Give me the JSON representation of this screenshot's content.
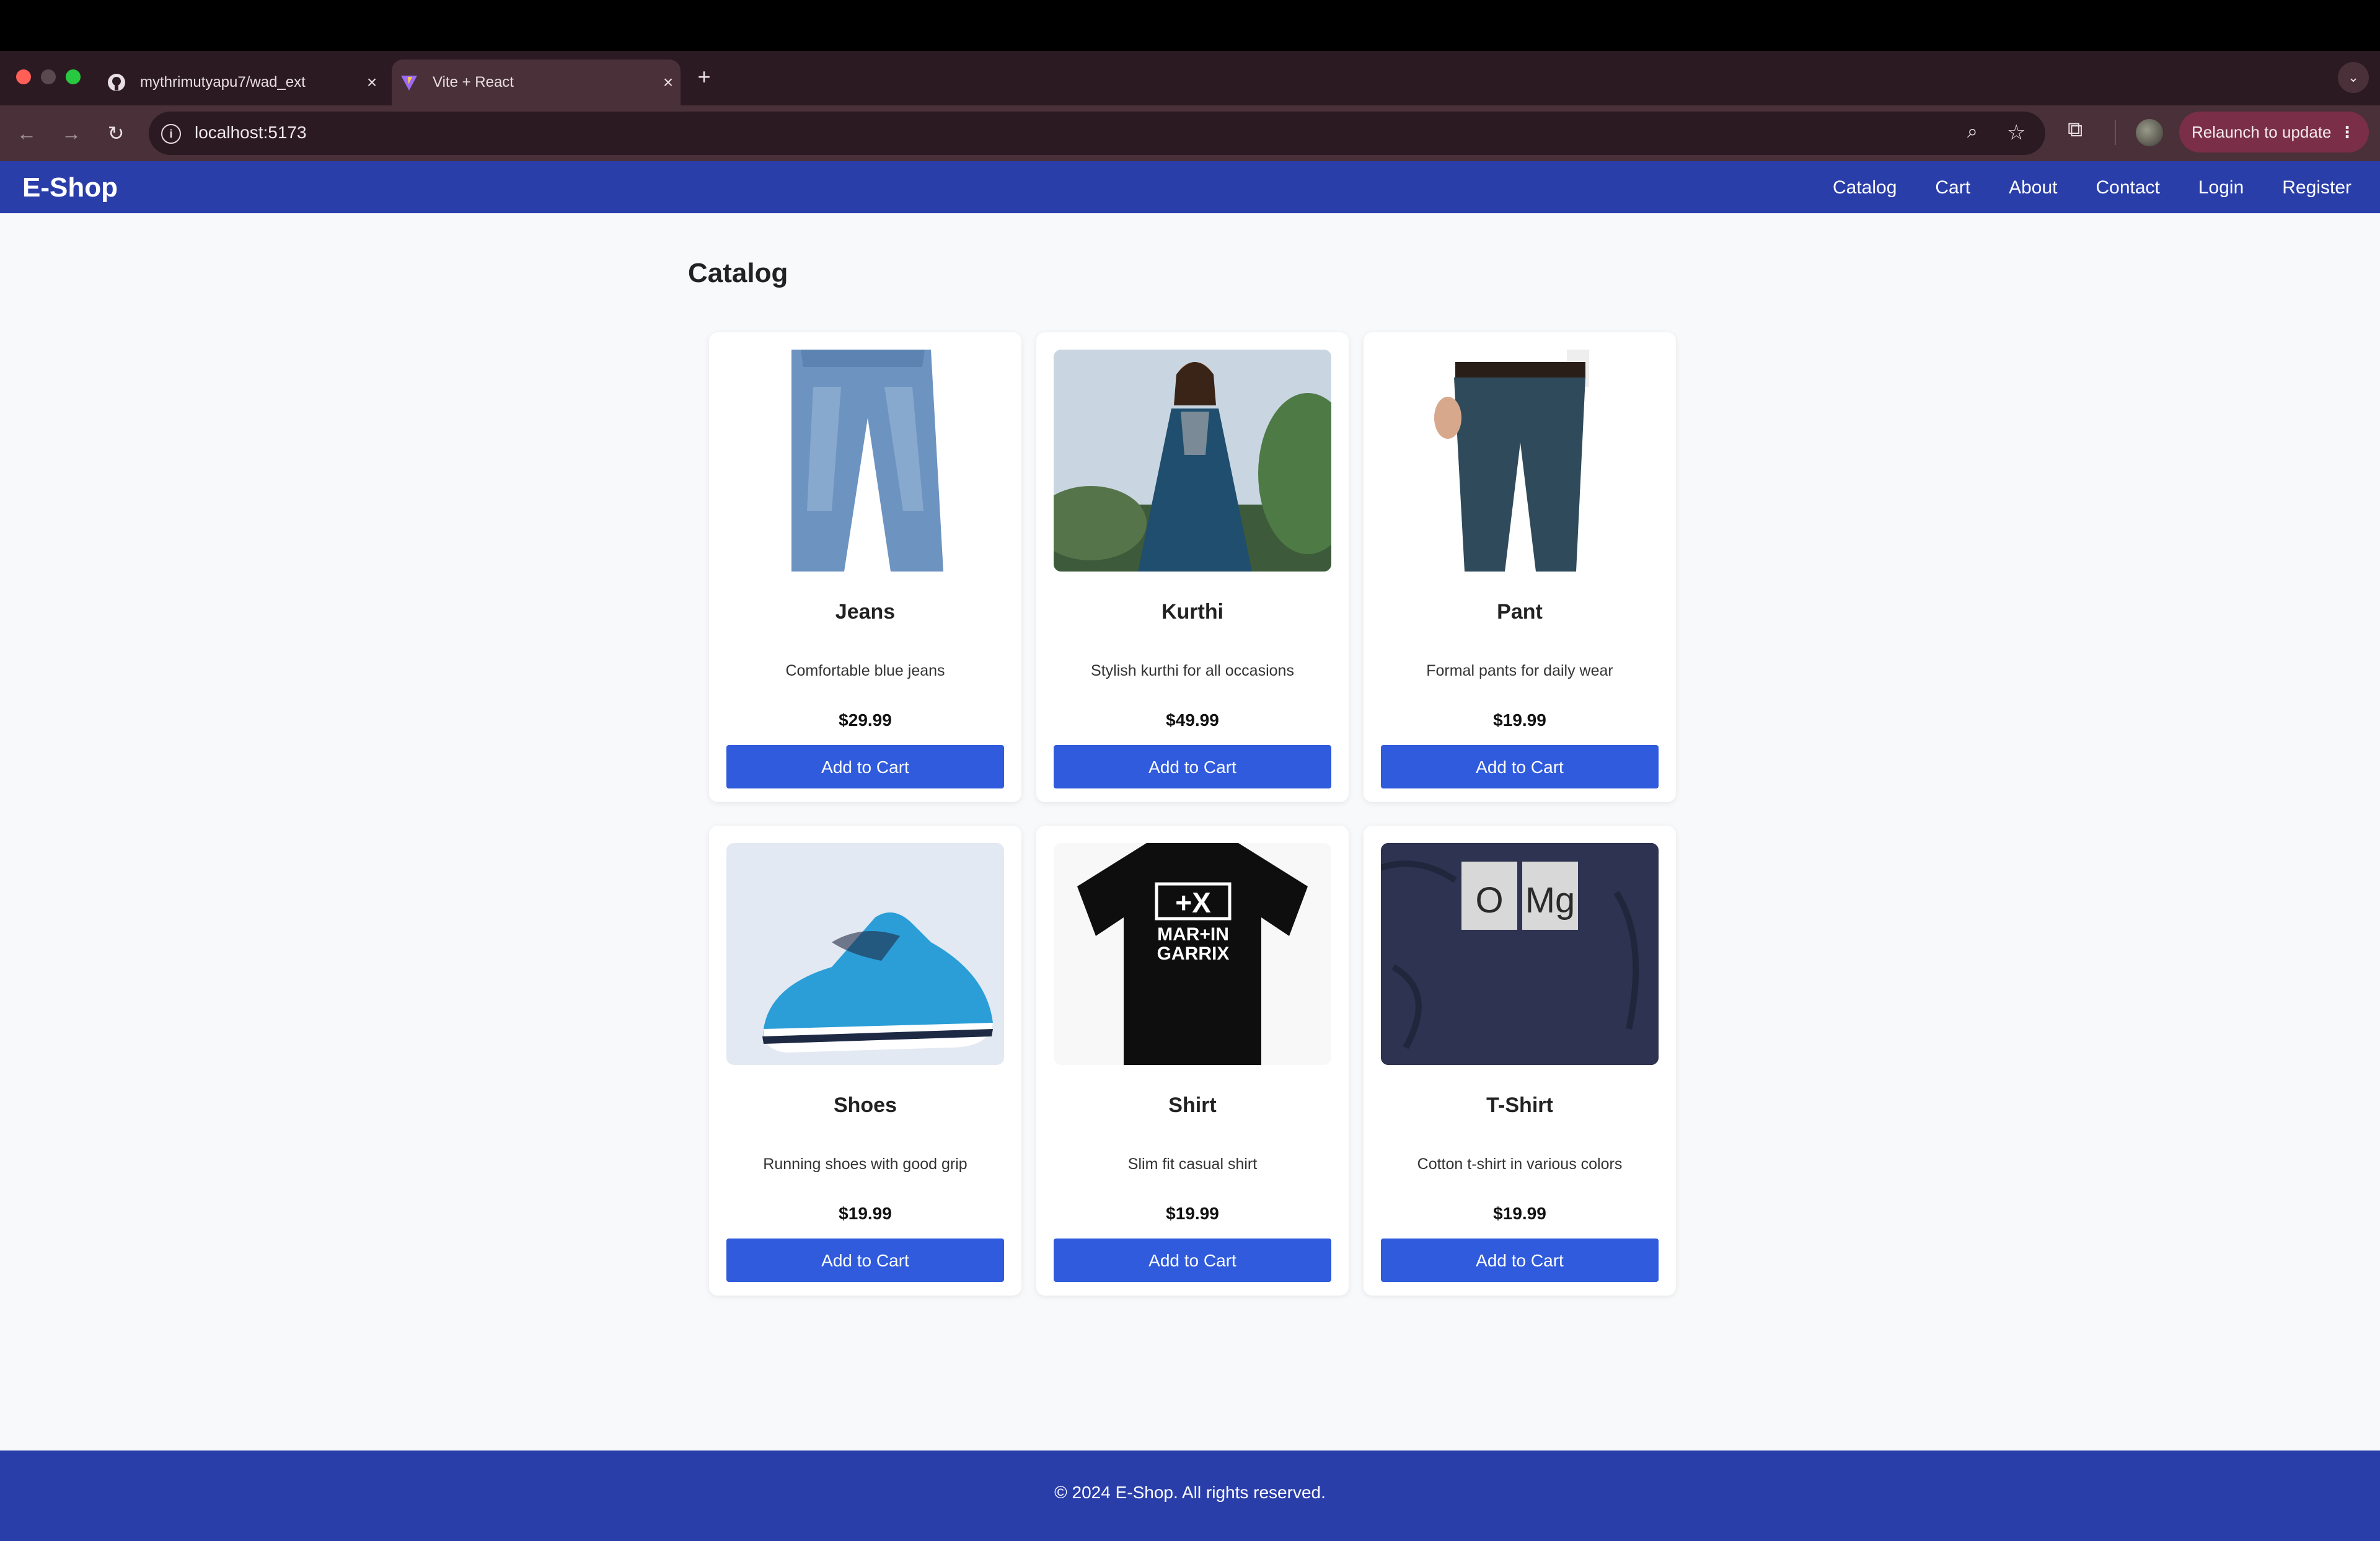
{
  "browser": {
    "tabs": [
      {
        "label": "mythrimutyapu7/wad_ext",
        "icon": "github-icon",
        "active": false
      },
      {
        "label": "Vite + React",
        "icon": "vite-icon",
        "active": true
      }
    ],
    "new_tab": "+",
    "close_glyph": "×",
    "url": "localhost:5173",
    "relaunch_label": "Relaunch to update"
  },
  "site": {
    "brand": "E-Shop",
    "nav": [
      "Catalog",
      "Cart",
      "About",
      "Contact",
      "Login",
      "Register"
    ],
    "accent": "#2a3eaa",
    "button_color": "#2f5bdc"
  },
  "catalog": {
    "title": "Catalog",
    "products": [
      {
        "name": "Jeans",
        "description": "Comfortable blue jeans",
        "price": "$29.99",
        "button": "Add to Cart",
        "image": "jeans-image"
      },
      {
        "name": "Kurthi",
        "description": "Stylish kurthi for all occasions",
        "price": "$49.99",
        "button": "Add to Cart",
        "image": "kurthi-image"
      },
      {
        "name": "Pant",
        "description": "Formal pants for daily wear",
        "price": "$19.99",
        "button": "Add to Cart",
        "image": "pant-image"
      },
      {
        "name": "Shoes",
        "description": "Running shoes with good grip",
        "price": "$19.99",
        "button": "Add to Cart",
        "image": "shoes-image"
      },
      {
        "name": "Shirt",
        "description": "Slim fit casual shirt",
        "price": "$19.99",
        "button": "Add to Cart",
        "image": "shirt-image"
      },
      {
        "name": "T-Shirt",
        "description": "Cotton t-shirt in various colors",
        "price": "$19.99",
        "button": "Add to Cart",
        "image": "tshirt-image"
      }
    ]
  },
  "shirt_print": {
    "line1": "+X",
    "line2": "MAR+IN",
    "line3": "GARRIX"
  },
  "tshirt_print": {
    "el1": "O",
    "el2": "Mg"
  },
  "footer": {
    "text": "© 2024 E-Shop. All rights reserved."
  }
}
